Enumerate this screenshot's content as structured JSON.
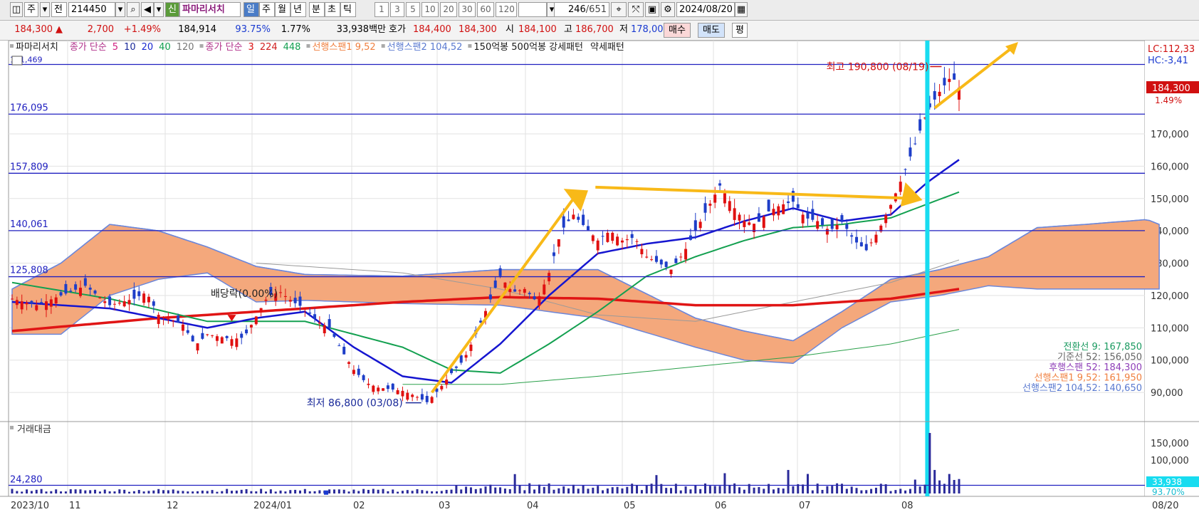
{
  "toolbar": {
    "market": "주",
    "prev": "전",
    "code": "214450",
    "new_badge": "신",
    "name": "파마리서치",
    "periods": [
      "일",
      "주",
      "월",
      "년",
      "분",
      "초",
      "틱"
    ],
    "selected_period": "일",
    "intervals": [
      "1",
      "3",
      "5",
      "10",
      "20",
      "30",
      "60",
      "120"
    ],
    "count": "246",
    "total": "/651",
    "date": "2024/08/20"
  },
  "quote": {
    "price": "184,300",
    "change": "2,700",
    "change_pct": "+1.49%",
    "avg": "184,914",
    "ratio": "93.75%",
    "turnover": "1.77%",
    "amount": "33,938백만",
    "ask_label": "호가",
    "ask1": "184,400",
    "ask2": "184,300",
    "open_label": "시",
    "open": "184,100",
    "high_label": "고",
    "high": "186,700",
    "low_label": "저",
    "low": "178,000",
    "buy": "매수",
    "sell": "매도",
    "eval": "평"
  },
  "legend": {
    "name": "파마리서치",
    "ma1_label": "종가 단순",
    "ma1_periods": [
      "5",
      "10",
      "20",
      "40",
      "120"
    ],
    "ma2_label": "종가 단순",
    "ma2_periods": [
      "3",
      "224",
      "448"
    ],
    "span1": "선행스팬1 9,52",
    "span2": "선행스팬2 104,52",
    "pattern": "150억봉 500억봉 강세패턴",
    "pattern2": "약세패턴"
  },
  "ichimoku": [
    {
      "label": "전환선 9: 167,850",
      "color": "#1a9a60"
    },
    {
      "label": "기준선 52: 156,050",
      "color": "#666666"
    },
    {
      "label": "후행스팬 52: 184,300",
      "color": "#8e3fb8"
    },
    {
      "label": "선행스팬1 9,52: 161,950",
      "color": "#f08040"
    },
    {
      "label": "선행스팬2 104,52: 140,650",
      "color": "#5a7ad0"
    }
  ],
  "chart_data": {
    "type": "candlestick",
    "y_ticks": [
      "90,000",
      "100,000",
      "110,000",
      "120,000",
      "130,000",
      "140,000",
      "150,000",
      "160,000",
      "170,000"
    ],
    "ylim": [
      81000,
      194000
    ],
    "x_ticks": [
      "2023/10",
      "11",
      "12",
      "2024/01",
      "02",
      "03",
      "04",
      "05",
      "06",
      "07",
      "08"
    ],
    "x_right_label": "08/20",
    "h_lines": [
      "176,095",
      "157,809",
      "140,061",
      "125,808"
    ],
    "top_line_label": "191,469",
    "high_marker": "최고 190,800 (08/19)",
    "low_marker": "최저 86,800 (03/08)",
    "dividend": "배당락(0.00%)",
    "right_labels": {
      "lc": "LC:112,33",
      "hc": "HC:-3,41",
      "price": "184,300",
      "pct": "1.49%"
    },
    "close_path": [
      [
        0,
        119000
      ],
      [
        10,
        117000
      ],
      [
        20,
        120000
      ],
      [
        30,
        123000
      ],
      [
        40,
        117000
      ],
      [
        50,
        119000
      ],
      [
        55,
        121000
      ],
      [
        60,
        114000
      ],
      [
        70,
        111000
      ],
      [
        75,
        104500
      ],
      [
        80,
        108000
      ],
      [
        90,
        106500
      ],
      [
        95,
        107000
      ],
      [
        100,
        113500
      ],
      [
        105,
        120000
      ],
      [
        110,
        121000
      ],
      [
        115,
        118000
      ],
      [
        120,
        116000
      ],
      [
        125,
        112000
      ],
      [
        130,
        110000
      ],
      [
        135,
        103000
      ],
      [
        140,
        97000
      ],
      [
        145,
        93000
      ],
      [
        150,
        91500
      ],
      [
        155,
        91000
      ],
      [
        160,
        90500
      ],
      [
        165,
        89000
      ],
      [
        170,
        87000
      ],
      [
        175,
        91000
      ],
      [
        180,
        96000
      ],
      [
        185,
        100000
      ],
      [
        190,
        108000
      ],
      [
        195,
        117000
      ],
      [
        200,
        126000
      ],
      [
        205,
        121000
      ],
      [
        210,
        122000
      ],
      [
        215,
        118000
      ],
      [
        220,
        127000
      ],
      [
        225,
        140000
      ],
      [
        230,
        145000
      ],
      [
        235,
        141000
      ],
      [
        240,
        137000
      ],
      [
        245,
        140000
      ],
      [
        250,
        137000
      ],
      [
        255,
        138000
      ],
      [
        260,
        132000
      ],
      [
        265,
        130000
      ],
      [
        270,
        128000
      ],
      [
        275,
        133000
      ],
      [
        280,
        140000
      ],
      [
        285,
        147000
      ],
      [
        290,
        154000
      ],
      [
        295,
        148000
      ],
      [
        300,
        143000
      ],
      [
        305,
        142000
      ],
      [
        310,
        146000
      ],
      [
        315,
        148000
      ],
      [
        320,
        149000
      ],
      [
        325,
        144000
      ],
      [
        330,
        143000
      ],
      [
        335,
        140000
      ],
      [
        340,
        143000
      ],
      [
        345,
        137000
      ],
      [
        350,
        134000
      ],
      [
        355,
        140000
      ],
      [
        360,
        148000
      ],
      [
        365,
        157000
      ],
      [
        370,
        167000
      ],
      [
        375,
        177000
      ],
      [
        380,
        183000
      ],
      [
        385,
        188000
      ],
      [
        388,
        184300
      ]
    ],
    "ma20": [
      [
        0,
        118000
      ],
      [
        40,
        116000
      ],
      [
        80,
        110000
      ],
      [
        100,
        113000
      ],
      [
        120,
        115000
      ],
      [
        140,
        104000
      ],
      [
        160,
        95000
      ],
      [
        180,
        93000
      ],
      [
        200,
        105000
      ],
      [
        220,
        120000
      ],
      [
        240,
        133000
      ],
      [
        260,
        136000
      ],
      [
        280,
        138000
      ],
      [
        300,
        143000
      ],
      [
        320,
        147000
      ],
      [
        340,
        143000
      ],
      [
        360,
        145000
      ],
      [
        375,
        155000
      ],
      [
        388,
        162000
      ]
    ],
    "ma60": [
      [
        0,
        124000
      ],
      [
        40,
        119000
      ],
      [
        80,
        112000
      ],
      [
        120,
        112000
      ],
      [
        160,
        104000
      ],
      [
        180,
        97000
      ],
      [
        200,
        96000
      ],
      [
        220,
        105000
      ],
      [
        240,
        115000
      ],
      [
        260,
        126000
      ],
      [
        280,
        132000
      ],
      [
        300,
        137000
      ],
      [
        320,
        141000
      ],
      [
        340,
        142000
      ],
      [
        360,
        144000
      ],
      [
        388,
        152000
      ]
    ],
    "ma120": [
      [
        0,
        109000
      ],
      [
        60,
        113000
      ],
      [
        120,
        116000
      ],
      [
        160,
        118000
      ],
      [
        200,
        119500
      ],
      [
        240,
        119000
      ],
      [
        280,
        117000
      ],
      [
        320,
        117000
      ],
      [
        360,
        119000
      ],
      [
        388,
        122000
      ]
    ],
    "ma224": [
      [
        100,
        130000
      ],
      [
        160,
        127000
      ],
      [
        200,
        122000
      ],
      [
        240,
        114000
      ],
      [
        280,
        112000
      ],
      [
        320,
        118000
      ],
      [
        360,
        124000
      ],
      [
        388,
        131000
      ]
    ],
    "lagging_base": [
      [
        160,
        92500
      ],
      [
        200,
        92500
      ],
      [
        240,
        95000
      ],
      [
        280,
        98000
      ],
      [
        320,
        101000
      ],
      [
        360,
        105000
      ],
      [
        388,
        109500
      ]
    ],
    "cloud_top": [
      [
        0,
        122000
      ],
      [
        20,
        130000
      ],
      [
        40,
        142000
      ],
      [
        60,
        140000
      ],
      [
        80,
        135000
      ],
      [
        100,
        129000
      ],
      [
        120,
        126500
      ],
      [
        160,
        126000
      ],
      [
        200,
        128000
      ],
      [
        240,
        128000
      ],
      [
        280,
        113000
      ],
      [
        300,
        109000
      ],
      [
        320,
        106000
      ],
      [
        340,
        115000
      ],
      [
        360,
        125000
      ],
      [
        380,
        128000
      ],
      [
        400,
        132000
      ],
      [
        420,
        141000
      ],
      [
        440,
        142000
      ],
      [
        465,
        143500
      ],
      [
        470,
        142000
      ]
    ],
    "cloud_bottom": [
      [
        0,
        108000
      ],
      [
        20,
        108000
      ],
      [
        40,
        120000
      ],
      [
        60,
        125000
      ],
      [
        80,
        127000
      ],
      [
        100,
        118000
      ],
      [
        120,
        118500
      ],
      [
        160,
        117500
      ],
      [
        200,
        117000
      ],
      [
        240,
        113000
      ],
      [
        280,
        104000
      ],
      [
        300,
        100000
      ],
      [
        320,
        99000
      ],
      [
        340,
        110000
      ],
      [
        360,
        118000
      ],
      [
        380,
        120000
      ],
      [
        400,
        123000
      ],
      [
        420,
        122000
      ],
      [
        440,
        122000
      ],
      [
        465,
        122000
      ],
      [
        470,
        122000
      ]
    ],
    "volume_label": "거래대금",
    "volume_ticks": [
      "100,000",
      "150,000"
    ],
    "volume_ref": "24,280",
    "volume_last": "33,938",
    "volume_last_pct": "93.70%",
    "volume_max": 180000
  }
}
